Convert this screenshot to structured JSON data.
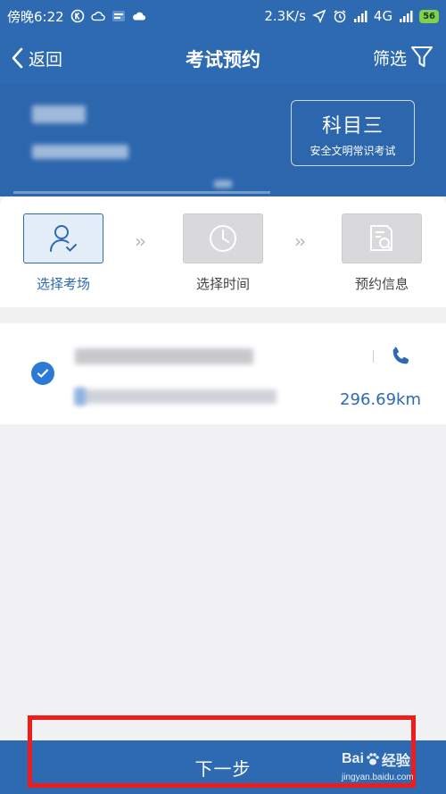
{
  "status_bar": {
    "time": "傍晚6:22",
    "net_speed": "2.3K/s",
    "network": "4G",
    "battery": "56",
    "icons_left": [
      "k-circle-icon",
      "cloud-sync-icon",
      "app-notification-icon",
      "cloud-icon"
    ],
    "icons_right": [
      "location-arrow-icon",
      "alarm-icon",
      "signal-icon",
      "signal-icon"
    ]
  },
  "nav": {
    "back_label": "返回",
    "title": "考试预约",
    "filter_label": "筛选"
  },
  "header": {
    "subject_name": "科目三",
    "subject_desc": "安全文明常识考试"
  },
  "steps": [
    {
      "label": "选择考场",
      "icon": "person-check-icon",
      "state": "active"
    },
    {
      "label": "选择时间",
      "icon": "clock-icon",
      "state": "inactive"
    },
    {
      "label": "预约信息",
      "icon": "document-search-icon",
      "state": "inactive"
    }
  ],
  "venue": {
    "selected": true,
    "distance": "296.69km"
  },
  "footer": {
    "next_label": "下一步"
  },
  "watermark": {
    "main": "Bai",
    "main_suffix": "经验",
    "url": "jingyan.baidu.com"
  },
  "colors": {
    "primary": "#2d6ab2",
    "highlight": "#ef1c1c"
  }
}
